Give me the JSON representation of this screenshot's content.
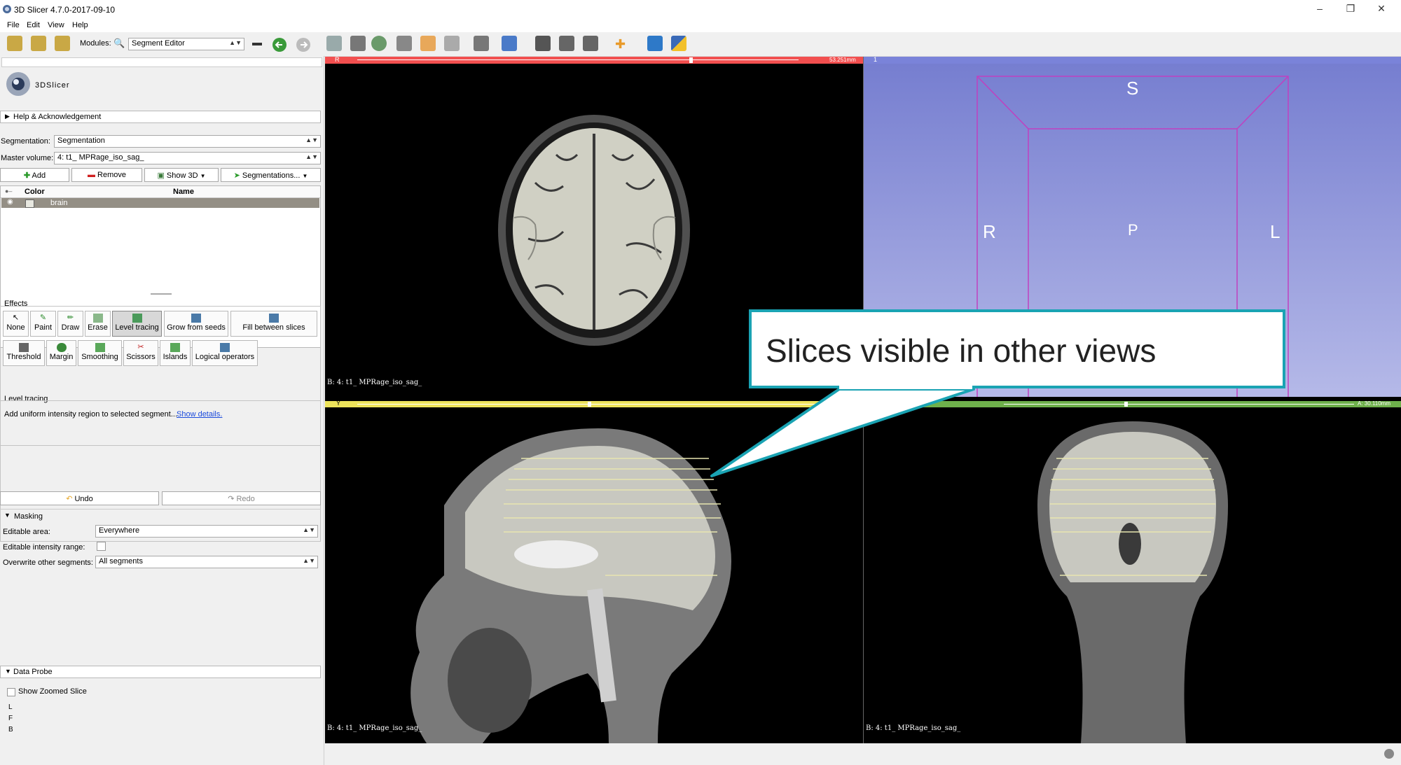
{
  "window": {
    "title": "3D Slicer 4.7.0-2017-09-10",
    "icon": "slicer-logo-icon",
    "controls": [
      "minimize-icon",
      "restore-icon",
      "close-icon"
    ]
  },
  "menu": [
    "File",
    "Edit",
    "View",
    "Help"
  ],
  "toolbar": {
    "modules_label": "Modules:",
    "module_value": "Segment Editor"
  },
  "logo_text": "3DSlicer",
  "help": {
    "label": "Help & Acknowledgement"
  },
  "segmentation": {
    "label": "Segmentation:",
    "value": "Segmentation"
  },
  "master_volume": {
    "label": "Master volume:",
    "value": "4: t1_ MPRage_iso_sag_"
  },
  "seg_buttons": {
    "add": "Add",
    "remove": "Remove",
    "show3d": "Show 3D",
    "segmentations": "Segmentations..."
  },
  "table": {
    "headers": [
      "Color",
      "Name"
    ],
    "rows": [
      {
        "name": "brain"
      }
    ]
  },
  "effects": {
    "label": "Effects",
    "row1": [
      "None",
      "Paint",
      "Draw",
      "Erase",
      "Level tracing",
      "Grow from seeds",
      "Fill between slices"
    ],
    "row2": [
      "Threshold",
      "Margin",
      "Smoothing",
      "Scissors",
      "Islands",
      "Logical operators"
    ],
    "active": "Level tracing"
  },
  "level_tracing": {
    "title": "Level tracing",
    "desc": "Add uniform intensity region to selected segment...",
    "link": "Show details."
  },
  "undo": "Undo",
  "redo": "Redo",
  "masking": {
    "title": "Masking",
    "editable_area_label": "Editable area:",
    "editable_area": "Everywhere",
    "intensity_label": "Editable intensity range:",
    "overwrite_label": "Overwrite other segments:",
    "overwrite": "All segments"
  },
  "data_probe": {
    "title": "Data Probe",
    "show_zoomed": "Show Zoomed Slice",
    "lines": [
      "L",
      "F",
      "B"
    ]
  },
  "views": {
    "red": {
      "letter": "R",
      "offset": "53.251mm",
      "label": "B: 4: t1_ MPRage_iso_sag_",
      "color": "#f24f4f"
    },
    "yellow": {
      "letter": "Y",
      "label": "B: 4: t1_ MPRage_iso_sag_",
      "color": "#ede35b"
    },
    "green": {
      "offset": "A: 30.110mm",
      "label": "B: 4: t1_ MPRage_iso_sag_",
      "color": "#6eb04b"
    },
    "threed": {
      "number": "1",
      "labels": {
        "top": "S",
        "left": "R",
        "center": "P",
        "right": "L"
      }
    }
  },
  "callout": {
    "text": "Slices visible in other views"
  }
}
